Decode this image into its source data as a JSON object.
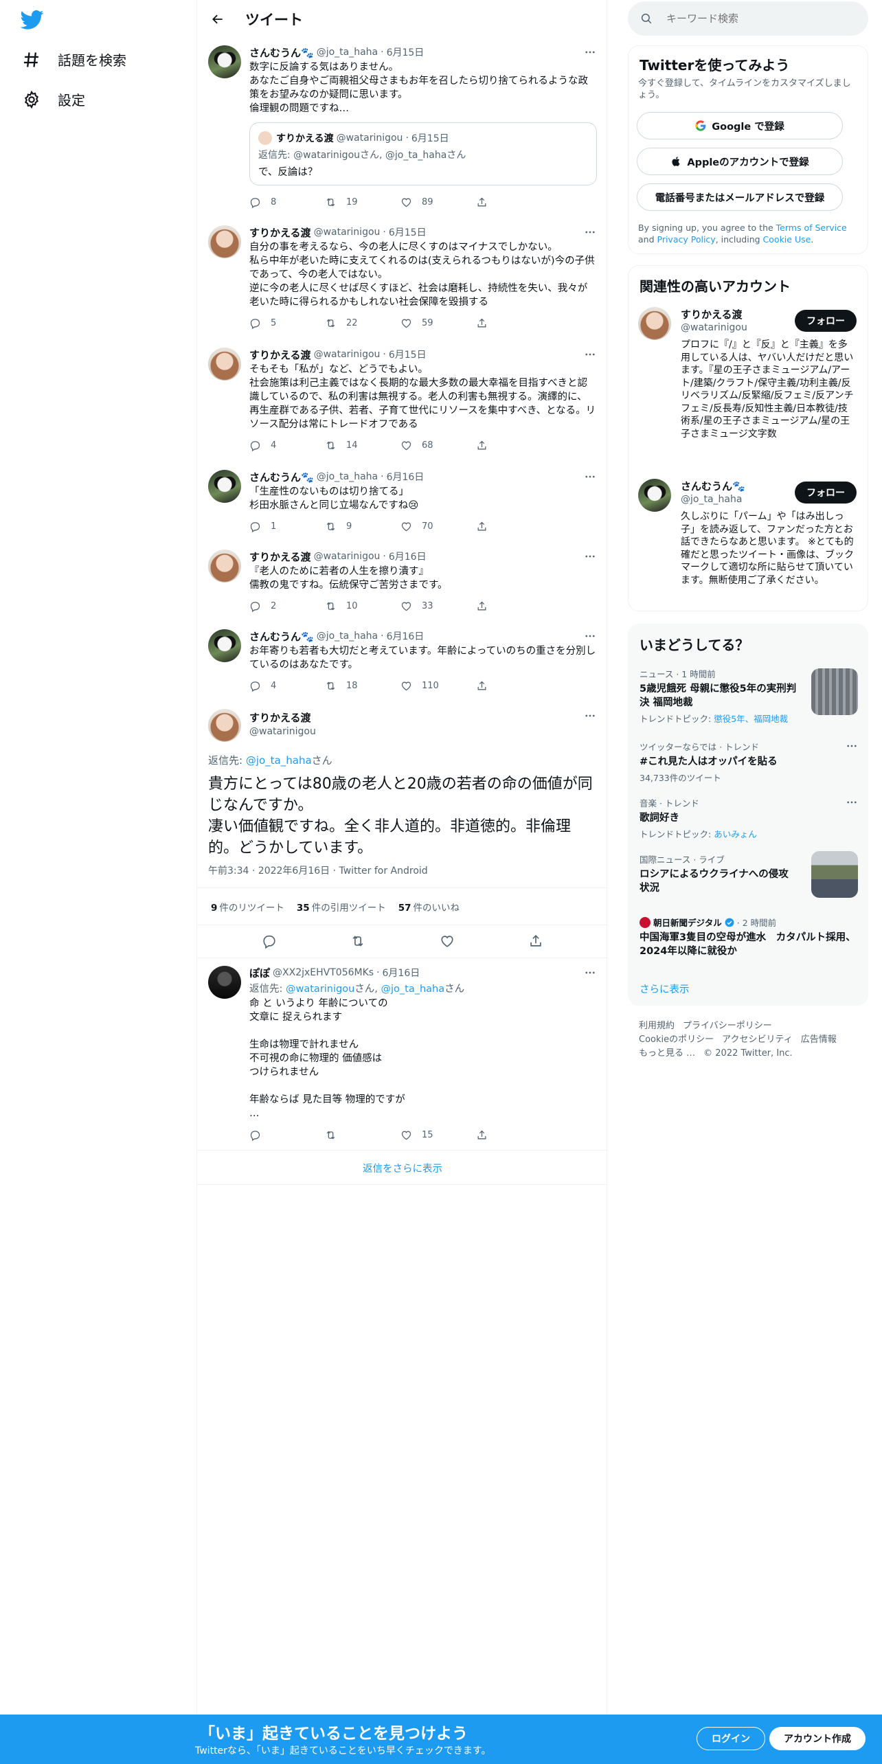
{
  "nav": {
    "explore": "話題を検索",
    "settings": "設定"
  },
  "header": {
    "title": "ツイート"
  },
  "thread": [
    {
      "name": "さんむうん🐾",
      "handle": "@jo_ta_haha",
      "date": "6月15日",
      "text": "数字に反論する気はありません。\nあなたご自身やご両親祖父母さまもお年を召したら切り捨てられるような政策をお望みなのか疑問に思います。\n倫理観の問題ですね…",
      "replies": "8",
      "retweets": "19",
      "likes": "89",
      "quote": {
        "name": "すりかえる渡",
        "handle": "@watarinigou",
        "date": "6月15日",
        "reply_prefix": "返信先: ",
        "reply_users": "@watarinigouさん, @jo_ta_hahaさん",
        "text": "で、反論は？"
      }
    },
    {
      "name": "すりかえる渡",
      "handle": "@watarinigou",
      "date": "6月15日",
      "text": "自分の事を考えるなら、今の老人に尽くすのはマイナスでしかない。\n私ら中年が老いた時に支えてくれるのは(支えられるつもりはないが)今の子供であって、今の老人ではない。\n逆に今の老人に尽くせば尽くすほど、社会は磨耗し、持続性を失い、我々が老いた時に得られるかもしれない社会保障を毀損する",
      "replies": "5",
      "retweets": "22",
      "likes": "59"
    },
    {
      "name": "すりかえる渡",
      "handle": "@watarinigou",
      "date": "6月15日",
      "text": "そもそも「私が」など、どうでもよい。\n社会施策は利己主義ではなく長期的な最大多数の最大幸福を目指すべきと認識しているので、私の利害は無視する。老人の利害も無視する。演繹的に、再生産群である子供、若者、子育て世代にリソースを集中すべき、となる。リソース配分は常にトレードオフである",
      "replies": "4",
      "retweets": "14",
      "likes": "68"
    },
    {
      "name": "さんむうん🐾",
      "handle": "@jo_ta_haha",
      "date": "6月16日",
      "text": "「生産性のないものは切り捨てる」\n杉田水脈さんと同じ立場なんですね😢",
      "replies": "1",
      "retweets": "9",
      "likes": "70"
    },
    {
      "name": "すりかえる渡",
      "handle": "@watarinigou",
      "date": "6月16日",
      "text": "『老人のために若者の人生を擦り潰す』\n儒教の鬼ですね。伝統保守ご苦労さまです。",
      "replies": "2",
      "retweets": "10",
      "likes": "33"
    },
    {
      "name": "さんむうん🐾",
      "handle": "@jo_ta_haha",
      "date": "6月16日",
      "text": "お年寄りも若者も大切だと考えています。年齢によっていのちの重さを分別しているのはあなたです。",
      "replies": "4",
      "retweets": "18",
      "likes": "110"
    }
  ],
  "focal": {
    "name": "すりかえる渡",
    "handle": "@watarinigou",
    "reply_prefix": "返信先: ",
    "reply_user": "@jo_ta_haha",
    "reply_suffix": "さん",
    "text": "貴方にとっては80歳の老人と20歳の若者の命の価値が同じなんですか。\n凄い価値観ですね。全く非人道的。非道徳的。非倫理的。どうかしています。",
    "meta": "午前3:34 · 2022年6月16日 · Twitter for Android",
    "retweets_count": "9",
    "retweets_label": "件のリツイート",
    "quotes_count": "35",
    "quotes_label": "件の引用ツイート",
    "likes_count": "57",
    "likes_label": "件のいいね"
  },
  "reply": {
    "name": "ぽぽ",
    "handle": "@XX2jxEHVT056MKs",
    "date": "6月16日",
    "reply_prefix": "返信先: ",
    "reply_user1": "@watarinigou",
    "reply_mid": "さん, ",
    "reply_user2": "@jo_ta_haha",
    "reply_suffix": "さん",
    "text": "命 と いうより 年齢についての\n文章に 捉えられます\n\n生命は物理で計れません\n不可視の命に物理的 価値感は\nつけられません\n\n年齢ならば 見た目等 物理的ですが\n…",
    "replies": "",
    "retweets": "",
    "likes": "15"
  },
  "show_more_replies": "返信をさらに表示",
  "sidebar": {
    "search_placeholder": "キーワード検索",
    "signup": {
      "title": "Twitterを使ってみよう",
      "subtitle": "今すぐ登録して、タイムラインをカスタマイズしましょう。",
      "google": "Google で登録",
      "apple": "Appleのアカウントで登録",
      "phone": "電話番号またはメールアドレスで登録",
      "terms_prefix": "By signing up, you agree to the ",
      "terms_link": "Terms of Service",
      "terms_mid": " and ",
      "privacy_link": "Privacy Policy",
      "terms_mid2": ", including ",
      "cookie_link": "Cookie Use",
      "terms_end": "."
    },
    "related": {
      "title": "関連性の高いアカウント",
      "accounts": [
        {
          "name": "すりかえる渡",
          "handle": "@watarinigou",
          "follow": "フォロー",
          "bio": "プロフに『/』と『反』と『主義』を多用している人は、ヤバい人だけだと思います。『星の王子さまミュージアム/アート/建築/クラフト/保守主義/功利主義/反リベラリズム/反緊縮/反フェミ/反アンチフェミ/反長寿/反知性主義/日本教徒/技術系/星の王子さまミュージアム/星の王子さまミュージ文字数"
        },
        {
          "name": "さんむうん🐾",
          "handle": "@jo_ta_haha",
          "follow": "フォロー",
          "bio": "久しぶりに「パーム」や「はみ出しっ子」を読み返して、ファンだった方とお話できたらなあと思います。 ※とても的確だと思ったツイート・画像は、ブックマークして適切な所に貼らせて頂いています。無断使用ご了承ください。"
        }
      ]
    },
    "trends": {
      "title": "いまどうしてる？",
      "items": [
        {
          "meta": "ニュース · 1 時間前",
          "title": "5歳児餓死 母親に懲役5年の実刑判決 福岡地裁",
          "sub_prefix": "トレンドトピック: ",
          "sub_link": "懲役5年、福岡地裁"
        },
        {
          "meta": "ツイッターならでは · トレンド",
          "title": "#これ見た人はオッパイを貼る",
          "sub_prefix": "34,733件のツイート",
          "sub_link": ""
        },
        {
          "meta": "音楽 · トレンド",
          "title": "歌詞好き",
          "sub_prefix": "トレンドトピック: ",
          "sub_link": "あいみょん"
        },
        {
          "meta": "国際ニュース · ライブ",
          "title": "ロシアによるウクライナへの侵攻状況",
          "sub_prefix": "",
          "sub_link": ""
        },
        {
          "meta": "朝日新聞デジタル",
          "meta2": " · 2 時間前",
          "title": "中国海軍3隻目の空母が進水　カタパルト採用、2024年以降に就役か",
          "sub_prefix": "",
          "sub_link": ""
        }
      ],
      "show_more": "さらに表示"
    },
    "footer": {
      "links": [
        "利用規約",
        "プライバシーポリシー",
        "Cookieのポリシー",
        "アクセシビリティ",
        "広告情報",
        "もっと見る …"
      ],
      "copyright": "© 2022 Twitter, Inc."
    }
  },
  "banner": {
    "title": "「いま」起きていることを見つけよう",
    "subtitle": "Twitterなら、「いま」起きていることをいち早くチェックできます。",
    "login": "ログイン",
    "signup": "アカウント作成"
  },
  "colors": {
    "accent": "#1d9bf0",
    "text": "#0f1419",
    "muted": "#536471",
    "border": "#eff3f4"
  }
}
